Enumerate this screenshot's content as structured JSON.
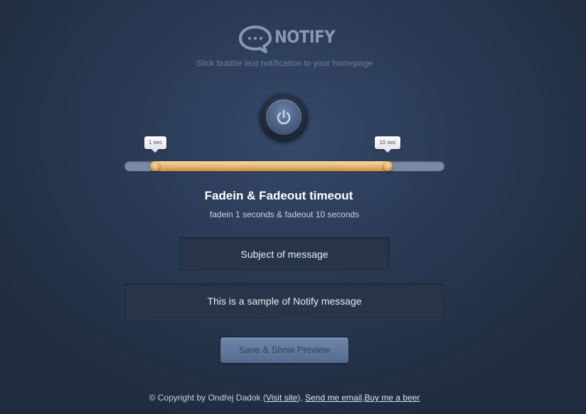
{
  "app": {
    "name": "NOTIFY",
    "tagline": "Slick bubble text notification to your homepage"
  },
  "power": {
    "state": "on"
  },
  "slider": {
    "min_seconds": 0,
    "max_seconds": 12,
    "fadein": 1,
    "fadeout": 10,
    "fadein_tooltip": "1 sec",
    "fadeout_tooltip": "10 sec",
    "range_color": "#e5b66c",
    "track_color": "#7a8aa3"
  },
  "timeout": {
    "title": "Fadein & Fadeout timeout",
    "summary": "fadein 1 seconds & fadeout 10 seconds"
  },
  "form": {
    "subject_value": "Subject of message",
    "message_value": "This is a sample of Notify message",
    "submit_label": "Save & Show Preview"
  },
  "footer": {
    "copyright": "© Copyright by Ondřej Dadok (",
    "visit_site": "Visit site",
    "close_paren": "),",
    "send_email": "Send me email",
    "comma": ",",
    "buy_beer": "Buy me a beer"
  },
  "icons": {
    "logo": "speech-bubble-icon",
    "power": "power-icon"
  },
  "colors": {
    "background": "#2a3a55",
    "accent": "#e5b66c",
    "button": "#566c91"
  }
}
